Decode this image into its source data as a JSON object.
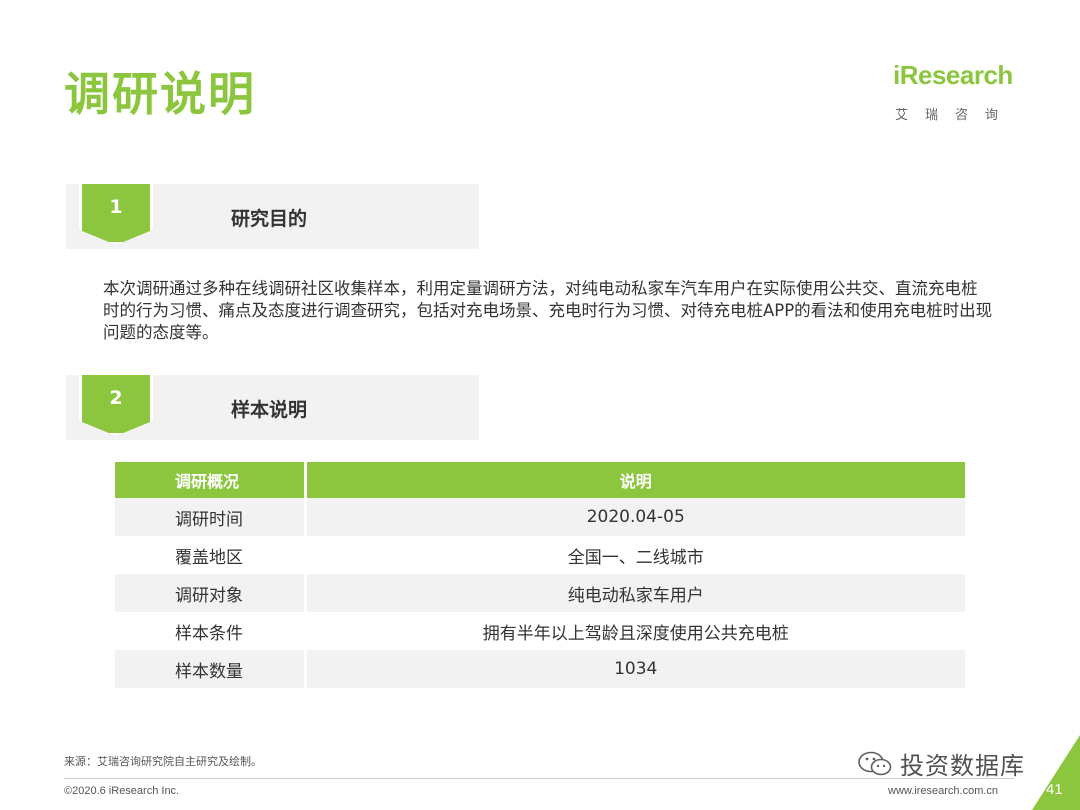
{
  "title": "调研说明",
  "logo": {
    "word": "iResearch",
    "sub": "艾瑞咨询"
  },
  "sections": [
    {
      "num": "1",
      "label": "研究目的"
    },
    {
      "num": "2",
      "label": "样本说明"
    }
  ],
  "purpose_text": "本次调研通过多种在线调研社区收集样本，利用定量调研方法，对纯电动私家车汽车用户在实际使用公共交、直流充电桩时的行为习惯、痛点及态度进行调查研究，包括对充电场景、充电时行为习惯、对待充电桩APP的看法和使用充电桩时出现问题的态度等。",
  "table": {
    "headers": [
      "调研概况",
      "说明"
    ],
    "rows": [
      [
        "调研时间",
        "2020.04-05"
      ],
      [
        "覆盖地区",
        "全国一、二线城市"
      ],
      [
        "调研对象",
        "纯电动私家车用户"
      ],
      [
        "样本条件",
        "拥有半年以上驾龄且深度使用公共充电桩"
      ],
      [
        "样本数量",
        "1034"
      ]
    ]
  },
  "footer": {
    "source": "来源：艾瑞咨询研究院自主研究及绘制。",
    "copyright": "©2020.6 iResearch Inc.",
    "website": "www.iresearch.com.cn",
    "page": "41",
    "watermark": "投资数据库"
  },
  "colors": {
    "accent": "#8cc63f",
    "band": "#f2f2f2"
  }
}
